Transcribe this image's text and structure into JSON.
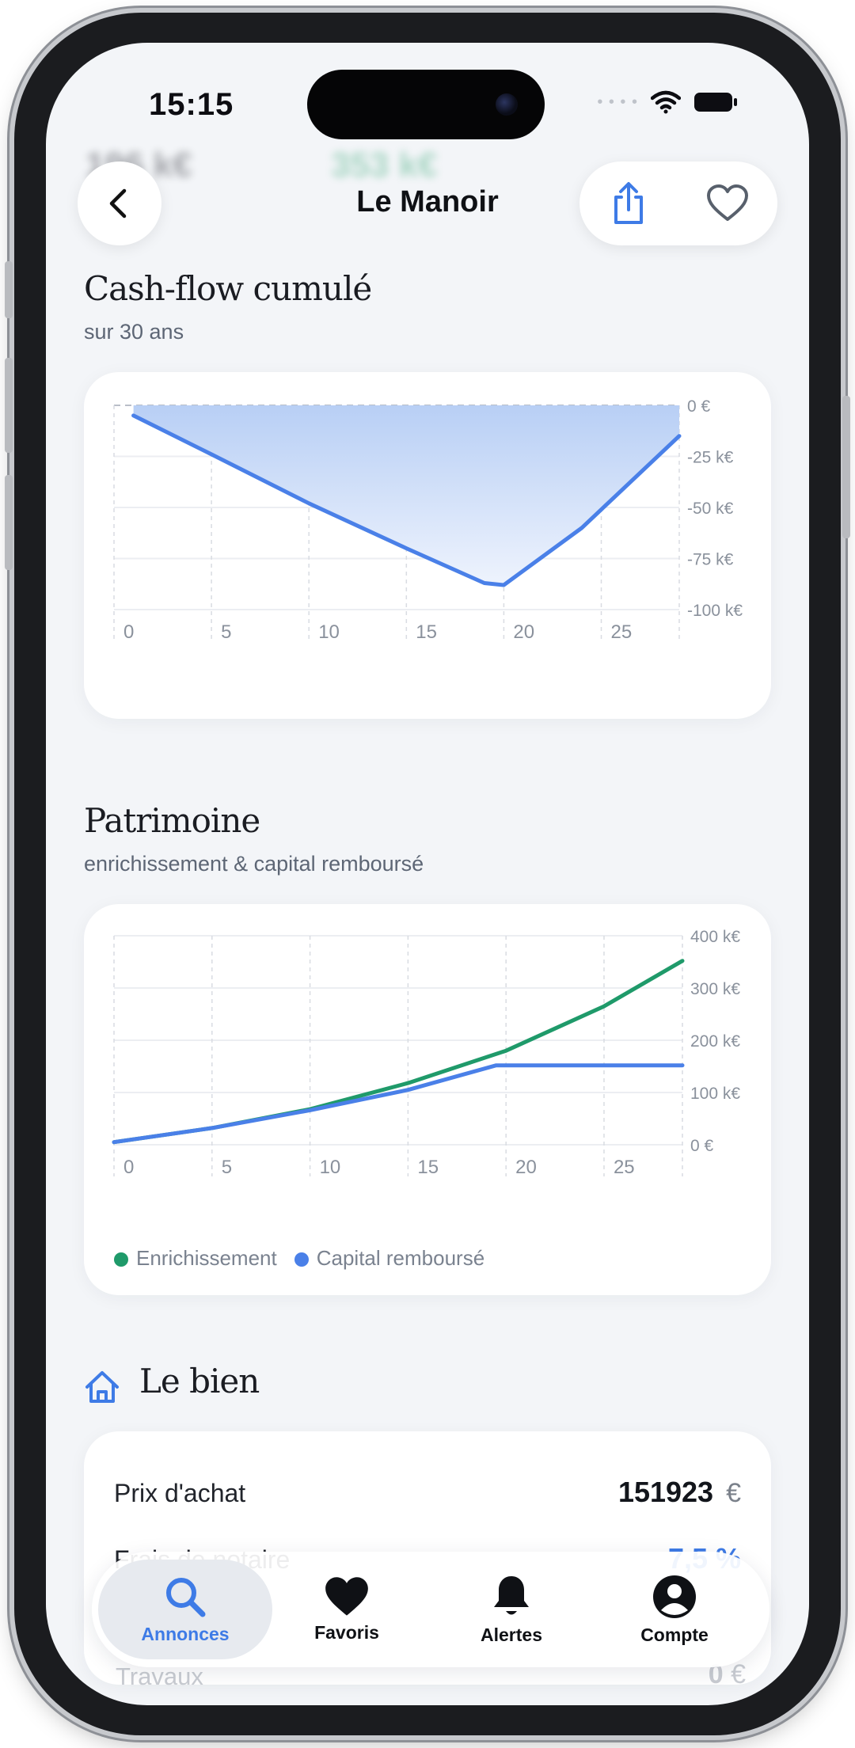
{
  "status": {
    "time": "15:15"
  },
  "background_stats": {
    "left": "196 k€",
    "right": "353 k€"
  },
  "header": {
    "title": "Le Manoir"
  },
  "cashflow": {
    "title": "Cash-flow cumulé",
    "subtitle": "sur 30 ans"
  },
  "patrimoine": {
    "title": "Patrimoine",
    "subtitle": "enrichissement & capital remboursé"
  },
  "chart_data": [
    {
      "type": "area",
      "xlim": [
        0,
        29
      ],
      "ylim": [
        -100000,
        0
      ],
      "x_ticks": [
        "0",
        "5",
        "10",
        "15",
        "20",
        "25"
      ],
      "y_ticks": [
        "0 €",
        "-25 k€",
        "-50 k€",
        "-75 k€",
        "-100 k€"
      ],
      "series": [
        {
          "color": "#4A80E8",
          "x": [
            1,
            5,
            10,
            15,
            19,
            20,
            24,
            29
          ],
          "y": [
            -5000,
            -24000,
            -48000,
            -70000,
            -87000,
            -88000,
            -60000,
            -15000
          ]
        }
      ],
      "grid": true
    },
    {
      "type": "line",
      "xlim": [
        0,
        29
      ],
      "ylim": [
        0,
        400000
      ],
      "x_ticks": [
        "0",
        "5",
        "10",
        "15",
        "20",
        "25"
      ],
      "y_ticks": [
        "400 k€",
        "300 k€",
        "200 k€",
        "100 k€",
        "0 €"
      ],
      "series": [
        {
          "name": "Enrichissement",
          "color": "#1F9A6A",
          "x": [
            0,
            5,
            10,
            15,
            20,
            25,
            30
          ],
          "y": [
            5000,
            32000,
            68000,
            118000,
            180000,
            265000,
            352000
          ]
        },
        {
          "name": "Capital remboursé",
          "color": "#4A80E8",
          "x": [
            0,
            5,
            10,
            15,
            19.5,
            20,
            25,
            30
          ],
          "y": [
            5000,
            32000,
            66000,
            105000,
            152000,
            152000,
            152000,
            152000
          ]
        }
      ],
      "legend": "bottom-left",
      "grid": true
    }
  ],
  "property": {
    "title": "Le bien",
    "rows": [
      {
        "label": "Prix d'achat",
        "value": "151923",
        "unit": "€"
      },
      {
        "label": "Frais de notaire",
        "value": "7,5 %"
      }
    ],
    "faded_row": {
      "label": "Travaux",
      "value": "0",
      "unit": "€"
    }
  },
  "tabbar": {
    "items": [
      {
        "label": "Annonces",
        "icon": "search-icon",
        "active": true
      },
      {
        "label": "Favoris",
        "icon": "heart-icon"
      },
      {
        "label": "Alertes",
        "icon": "bell-icon"
      },
      {
        "label": "Compte",
        "icon": "account-icon"
      }
    ]
  },
  "colors": {
    "accent": "#3E7BE6",
    "green": "#1F9A6A",
    "background": "#F3F5F8"
  }
}
